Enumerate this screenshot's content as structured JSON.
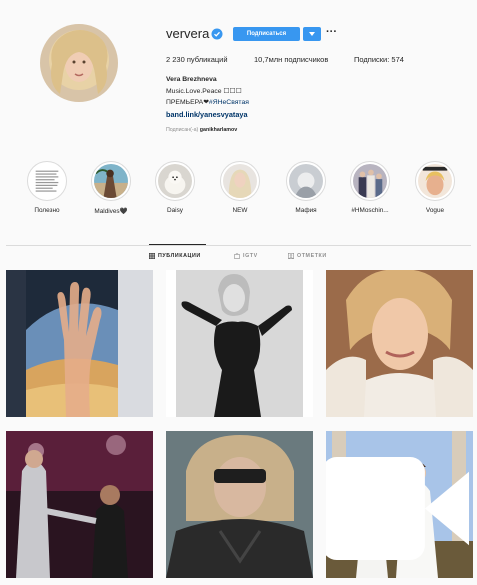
{
  "profile": {
    "username": "ververa",
    "follow_label": "Подписаться",
    "more_label": "···",
    "stats": {
      "posts": "2 230 публикаций",
      "followers": "10,7млн подписчиков",
      "following": "Подписки: 574"
    },
    "bio": {
      "full_name": "Vera Brezhneva",
      "line1": "Music.Love.Peace ☐☐☐",
      "line2_prefix": "ПРЕМЬЕРА❤",
      "line2_tag": "#ЯНеСвятая",
      "link": "band.link/yanesvyataya"
    },
    "followed_by_prefix": "Подписан(-а) ",
    "followed_by_user": "ganikharlamov"
  },
  "highlights": [
    {
      "label": "Полезно",
      "icon": "document-thumbnail"
    },
    {
      "label": "Maldives🖤",
      "icon": "beach-thumbnail"
    },
    {
      "label": "Daisy",
      "icon": "dog-thumbnail"
    },
    {
      "label": "NEW",
      "icon": "portrait-thumbnail"
    },
    {
      "label": "Мафия",
      "icon": "portrait-thumbnail"
    },
    {
      "label": "#HMoschin...",
      "icon": "group-thumbnail"
    },
    {
      "label": "Vogue",
      "icon": "magazine-thumbnail"
    }
  ],
  "tabs": [
    {
      "label": "ПУБЛИКАЦИИ",
      "icon": "grid-icon",
      "active": true
    },
    {
      "label": "IGTV",
      "icon": "igtv-icon",
      "active": false
    },
    {
      "label": "ОТМЕТКИ",
      "icon": "tag-icon",
      "active": false
    }
  ],
  "colors": {
    "accent": "#3897f0",
    "background": "#fafafa",
    "text": "#262626",
    "muted": "#8e8e8e",
    "link": "#003569",
    "border": "#dbdbdb"
  }
}
